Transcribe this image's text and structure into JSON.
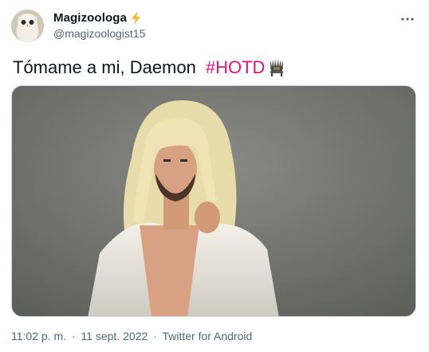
{
  "author": {
    "display_name": "Magizoologa",
    "handle": "@magizoologist15",
    "avatar_icon": "owl-avatar",
    "badge_icon": "lightning-bolt-icon"
  },
  "tweet": {
    "text": "Tómame a mi, Daemon",
    "hashtag": "#HOTD",
    "hashtag_color": "#e0127a",
    "emoji_icon": "iron-throne-emoji"
  },
  "media": {
    "type": "photo"
  },
  "meta": {
    "time": "11:02 p. m.",
    "separator": "·",
    "date": "11 sept. 2022",
    "source": "Twitter for Android"
  },
  "more_icon": "more-options-icon"
}
